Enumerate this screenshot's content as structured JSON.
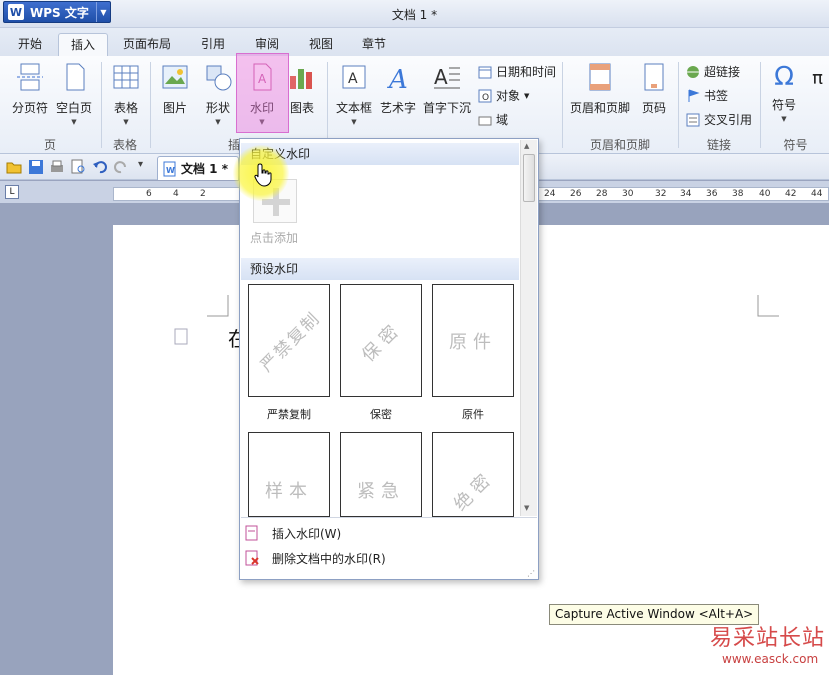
{
  "app": {
    "name": "WPS 文字",
    "window_title": "文档 1 *"
  },
  "tabs": [
    "开始",
    "插入",
    "页面布局",
    "引用",
    "审阅",
    "视图",
    "章节"
  ],
  "ribbon": {
    "buttons": {
      "page_break": "分页符",
      "blank_page": "空白页",
      "table": "表格",
      "picture": "图片",
      "shape": "形状",
      "watermark": "水印",
      "chart": "图表",
      "textbox": "文本框",
      "wordart": "艺术字",
      "dropcap": "首字下沉",
      "header_footer": "页眉和页脚",
      "page_number": "页码",
      "symbol": "符号",
      "pi": "π"
    },
    "small": {
      "datetime": "日期和时间",
      "object": "对象",
      "field": "域",
      "hyperlink": "超链接",
      "bookmark": "书签",
      "crossref": "交叉引用"
    },
    "groups": {
      "page": "页",
      "table": "表格",
      "insert_partial": "插",
      "header_footer": "页眉和页脚",
      "link": "链接",
      "symbol": "符号"
    }
  },
  "doc_tab": {
    "label": "文档 1 *"
  },
  "ruler": {
    "numbers": [
      "6",
      "4",
      "2",
      "24",
      "26",
      "28",
      "30",
      "32",
      "34",
      "36",
      "38",
      "40",
      "42",
      "44"
    ],
    "corner": "L"
  },
  "document": {
    "visible_char": "在"
  },
  "watermark_menu": {
    "custom_header": "自定义水印",
    "add_label": "点击添加",
    "preset_header": "预设水印",
    "presets": [
      {
        "text": "严禁复制",
        "caption": "严禁复制"
      },
      {
        "text": "保密",
        "caption": "保密"
      },
      {
        "text": "原件",
        "caption": "原件"
      },
      {
        "text": "样本",
        "caption": ""
      },
      {
        "text": "紧急",
        "caption": ""
      },
      {
        "text": "绝密",
        "caption": ""
      }
    ],
    "insert_label": "插入水印(W)",
    "delete_label": "删除文档中的水印(R)"
  },
  "tooltip": "Capture Active Window <Alt+A>",
  "site_watermark": {
    "name": "易采站长站",
    "url": "www.easck.com"
  }
}
